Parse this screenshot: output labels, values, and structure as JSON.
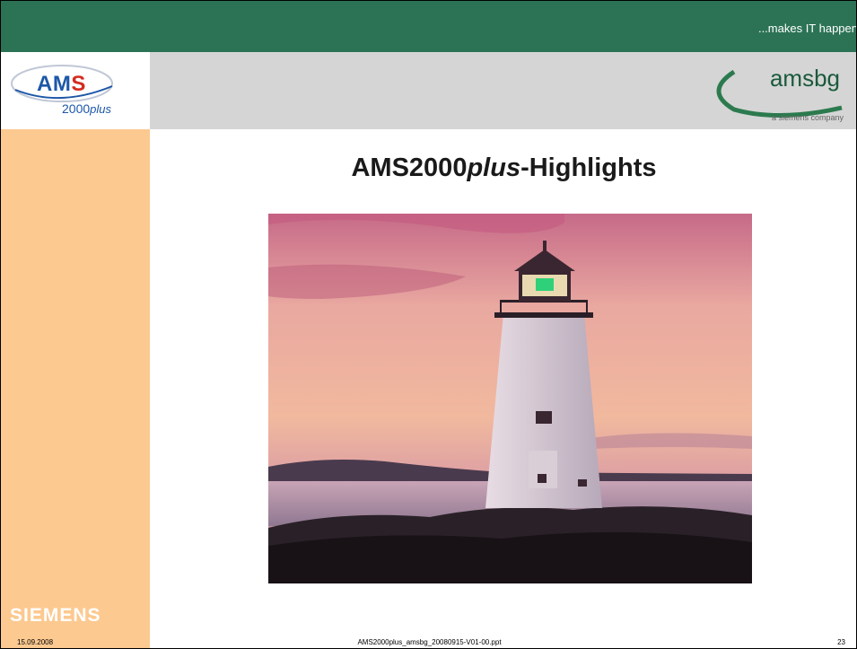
{
  "header": {
    "tagline": "...makes IT happen"
  },
  "logo_left": {
    "brand_a": "AM",
    "brand_b": "S",
    "version": "2000",
    "version_suffix": "plus"
  },
  "logo_right": {
    "brand": "amsbg",
    "subtitle": "a siemens company"
  },
  "sidebar": {
    "company": "SIEMENS"
  },
  "slide": {
    "title_prefix": "AMS2000",
    "title_italic": "plus",
    "title_suffix": "-Highlights",
    "image": "lighthouse-at-dusk-photo"
  },
  "footer": {
    "date": "15.09.2008",
    "filename": "AMS2000plus_amsbg_20080915-V01-00.ppt",
    "page_number": "23"
  }
}
